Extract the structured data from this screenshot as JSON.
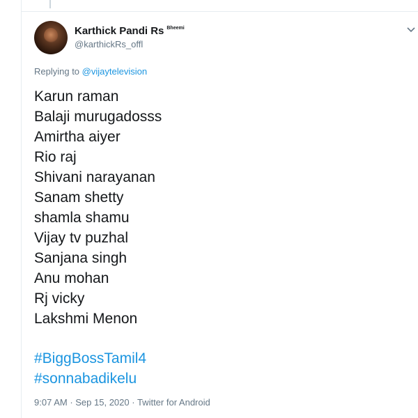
{
  "author": {
    "display_name": "Karthick Pandi Rs",
    "name_suffix": "Bheemi",
    "handle": "@karthickRs_offl"
  },
  "reply": {
    "prefix": "Replying to ",
    "target": "@vijaytelevision"
  },
  "tweet": {
    "lines": [
      "Karun raman",
      "Balaji murugadosss",
      "Amirtha aiyer",
      "Rio raj",
      "Shivani narayanan",
      "Sanam shetty",
      "shamla shamu",
      "Vijay tv puzhal",
      "Sanjana singh",
      "Anu mohan",
      "Rj vicky",
      "Lakshmi Menon"
    ],
    "hashtags": [
      "#BiggBossTamil4",
      "#sonnabadikelu"
    ]
  },
  "meta": {
    "time": "9:07 AM",
    "date": "Sep 15, 2020",
    "source": "Twitter for Android",
    "separator": " · "
  },
  "icons": {
    "more": "chevron-down-icon"
  },
  "colors": {
    "link": "#1b95e0",
    "secondary_text": "#657786",
    "primary_text": "#14171a",
    "border": "#e6ecf0"
  }
}
